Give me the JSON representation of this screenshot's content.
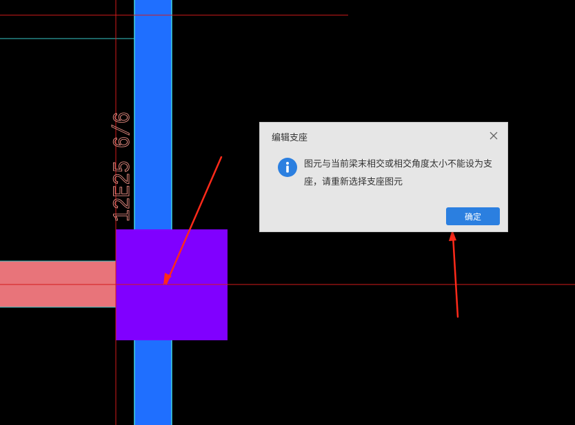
{
  "drawing": {
    "beam_label": "12E25 6/6",
    "colors": {
      "background": "#000000",
      "column_fill": "#1f6fff",
      "column_edge": "#3fd6e8",
      "support_fill": "#8000ff",
      "beam_fill": "#e8747a",
      "axis_line": "#d41a1a",
      "cyan_line": "#38c8c8",
      "arrow": "#ff2a1a",
      "label": "#e48a80"
    }
  },
  "dialog": {
    "title": "编辑支座",
    "message": "图元与当前梁末相交或相交角度太小不能设为支座，请重新选择支座图元",
    "confirm_label": "确定",
    "icons": {
      "close": "close-icon",
      "info": "info-icon"
    },
    "accent_color": "#2b7fe0"
  }
}
